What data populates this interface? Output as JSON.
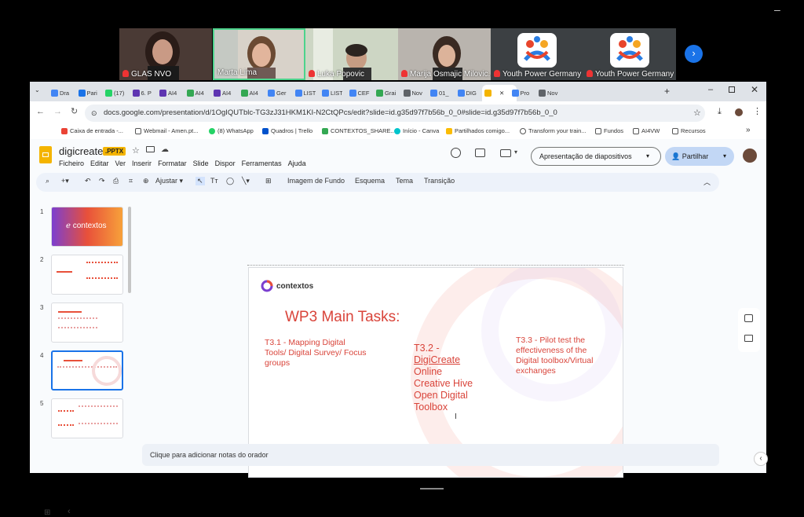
{
  "meeting": {
    "participants": [
      {
        "name": "GLAS NVO"
      },
      {
        "name": "Marta Lima"
      },
      {
        "name": "Luka Popovic"
      },
      {
        "name": "Marija Osmajic Milovic..."
      },
      {
        "name": "Youth Power Germany"
      },
      {
        "name": "Youth Power Germany"
      }
    ],
    "window_minimize": "–"
  },
  "browser": {
    "tabs": [
      "Dra",
      "Pari",
      "(17)",
      "6. P",
      "AI4",
      "AI4",
      "AI4",
      "AI4",
      "Ger",
      "LIST",
      "LIST",
      "CEF",
      "Grai",
      "Nov",
      "01_",
      "DIG",
      "",
      "Pro",
      "Nov"
    ],
    "tab_colors": [
      "#4285f4",
      "#1a73e8",
      "#25d366",
      "#5e35b1",
      "#5e35b1",
      "#34a853",
      "#5e35b1",
      "#34a853",
      "#4285f4",
      "#4285f4",
      "#4285f4",
      "#4285f4",
      "#34a853",
      "#5f6368",
      "#4285f4",
      "#4285f4",
      "#f4b400",
      "#4285f4",
      "#5f6368"
    ],
    "new_tab": "+",
    "url": "docs.google.com/presentation/d/1OgIQUTblc-TG3zJ31HKM1KI-N2CtQPcs/edit?slide=id.g35d97f7b56b_0_0#slide=id.g35d97f7b56b_0_0",
    "bookmarks": [
      "Caixa de entrada -...",
      "Webmail - Amen.pt...",
      "(8) WhatsApp",
      "Quadros | Trello",
      "CONTEXTOS_SHARE...",
      "Início - Canva",
      "Partilhados comigo...",
      "Transform your train...",
      "Fundos",
      "AI4VW",
      "Recursos"
    ],
    "bookmark_more": "»"
  },
  "docs": {
    "title": "digicreate",
    "badge": ".PPTX",
    "menu": [
      "Ficheiro",
      "Editar",
      "Ver",
      "Inserir",
      "Formatar",
      "Slide",
      "Dispor",
      "Ferramentas",
      "Ajuda"
    ],
    "present_button": "Apresentação de diapositivos",
    "share_button": "Partilhar",
    "toolbar": {
      "zoom": "Ajustar",
      "background": "Imagem de Fundo",
      "layout": "Esquema",
      "theme": "Tema",
      "transition": "Transição"
    },
    "slide_numbers": [
      "1",
      "2",
      "3",
      "4",
      "5"
    ],
    "thumb1_logo": "contextos",
    "notes_placeholder": "Clique para adicionar notas do orador"
  },
  "slide": {
    "logo": "contextos",
    "title": "WP3 Main Tasks:",
    "col1": "T3.1 - Mapping Digital Tools/ Digital Survey/ Focus groups",
    "col2_id": "T3.2 -",
    "col2_link": "DigiCreate",
    "col2_rest": "Online Creative Hive Open Digital Toolbox",
    "col3": "T3.3 - Pilot test the effectiveness of the Digital toolbox/Virtual exchanges"
  },
  "colors": {
    "accent_red": "#d9443a",
    "share_blue": "#c2d7f5",
    "docs_yellow": "#f4b400"
  }
}
